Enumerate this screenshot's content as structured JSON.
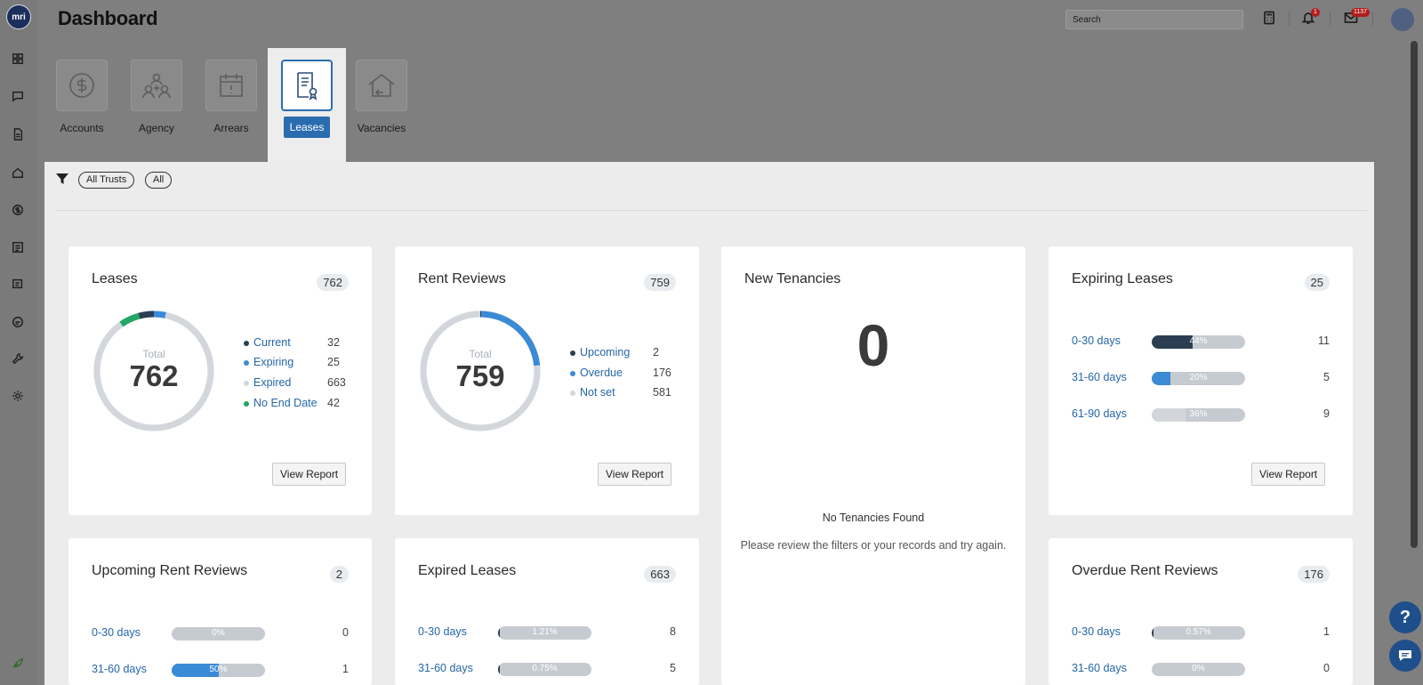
{
  "app": {
    "logo_text": "mri",
    "page_title": "Dashboard"
  },
  "header": {
    "search_placeholder": "Search",
    "notifications_badge": "1",
    "messages_badge": "1137"
  },
  "nav_rail": [
    "dashboard-icon",
    "chat-icon",
    "document-icon",
    "home-icon",
    "dollar-icon",
    "ledger-icon",
    "receipt-icon",
    "id-card-icon",
    "wrench-icon",
    "settings-icon",
    "leaf-icon"
  ],
  "tiles": [
    {
      "label": "Accounts",
      "icon": "dollar-icon",
      "active": false
    },
    {
      "label": "Agency",
      "icon": "people-icon",
      "active": false
    },
    {
      "label": "Arrears",
      "icon": "calendar-icon",
      "active": false
    },
    {
      "label": "Leases",
      "icon": "lease-document-icon",
      "active": true
    },
    {
      "label": "Vacancies",
      "icon": "house-icon",
      "active": false
    }
  ],
  "filters": {
    "chips": [
      "All Trusts",
      "All"
    ]
  },
  "cards": {
    "leases": {
      "title": "Leases",
      "count": "762",
      "total_label": "Total",
      "total_value": "762",
      "legend": [
        {
          "label": "Current",
          "value": "32",
          "color": "#2b3e52"
        },
        {
          "label": "Expiring",
          "value": "25",
          "color": "#3a8ad6"
        },
        {
          "label": "Expired",
          "value": "663",
          "color": "#d3d7dc"
        },
        {
          "label": "No End Date",
          "value": "42",
          "color": "#22a565"
        }
      ],
      "button": "View Report"
    },
    "rent_reviews": {
      "title": "Rent Reviews",
      "count": "759",
      "total_label": "Total",
      "total_value": "759",
      "legend": [
        {
          "label": "Upcoming",
          "value": "2",
          "color": "#2b3e52"
        },
        {
          "label": "Overdue",
          "value": "176",
          "color": "#3a8ad6"
        },
        {
          "label": "Not set",
          "value": "581",
          "color": "#d3d7dc"
        }
      ],
      "button": "View Report"
    },
    "new_tenancies": {
      "title": "New Tenancies",
      "big_value": "0",
      "empty_title": "No Tenancies Found",
      "empty_sub": "Please review the filters or your records and try again."
    },
    "expiring_leases": {
      "title": "Expiring Leases",
      "count": "25",
      "rows": [
        {
          "label": "0-30 days",
          "pct": "44%",
          "fill": 0.44,
          "color": "#2b3e52",
          "value": "11"
        },
        {
          "label": "31-60 days",
          "pct": "20%",
          "fill": 0.2,
          "color": "#3a8ad6",
          "value": "5"
        },
        {
          "label": "61-90 days",
          "pct": "36%",
          "fill": 0.36,
          "color": "#d3d7dc",
          "value": "9"
        }
      ],
      "button": "View Report"
    },
    "upcoming_rent_reviews": {
      "title": "Upcoming Rent Reviews",
      "count": "2",
      "rows": [
        {
          "label": "0-30 days",
          "pct": "0%",
          "fill": 0,
          "color": "#2b3e52",
          "value": "0"
        },
        {
          "label": "31-60 days",
          "pct": "50%",
          "fill": 0.5,
          "color": "#3a8ad6",
          "value": "1"
        }
      ]
    },
    "expired_leases": {
      "title": "Expired Leases",
      "count": "663",
      "rows": [
        {
          "label": "0-30 days",
          "pct": "1.21%",
          "fill": 0.0121,
          "color": "#2b3e52",
          "value": "8"
        },
        {
          "label": "31-60 days",
          "pct": "0.75%",
          "fill": 0.0075,
          "color": "#2b3e52",
          "value": "5"
        }
      ]
    },
    "overdue_rent_reviews": {
      "title": "Overdue Rent Reviews",
      "count": "176",
      "rows": [
        {
          "label": "0-30 days",
          "pct": "0.57%",
          "fill": 0.0057,
          "color": "#2b3e52",
          "value": "1"
        },
        {
          "label": "31-60 days",
          "pct": "0%",
          "fill": 0,
          "color": "#2b3e52",
          "value": "0"
        }
      ]
    }
  },
  "help": {
    "label": "?"
  }
}
